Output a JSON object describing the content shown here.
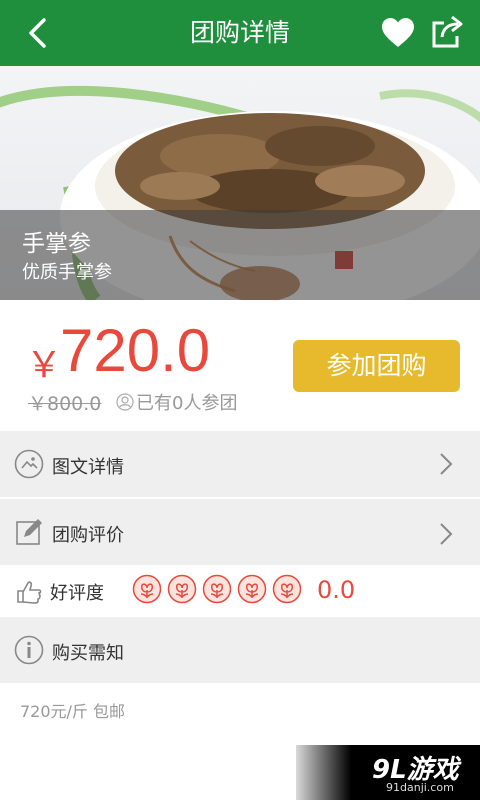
{
  "header": {
    "title": "团购详情"
  },
  "product": {
    "name": "手掌参",
    "subtitle": "优质手掌参"
  },
  "pricing": {
    "currency": "￥",
    "price": "720.0",
    "original_price": "￥800.0",
    "participants": "已有0人参团",
    "join_label": "参加团购"
  },
  "sections": {
    "details_label": "图文详情",
    "reviews_label": "团购评价",
    "rating_label": "好评度",
    "rating_score": "0.0",
    "notice_label": "购买需知",
    "notice_text": "720元/斤 包邮"
  },
  "watermark": {
    "main": "9L游戏",
    "sub": "91danji.com"
  },
  "colors": {
    "header": "#1f8f3d",
    "price": "#e8493c",
    "button": "#e7b92c"
  },
  "icons": [
    "back-icon",
    "heart-icon",
    "share-icon",
    "image-text-icon",
    "edit-icon",
    "thumb-icon",
    "star-icon",
    "info-icon",
    "chevron-right-icon",
    "user-icon"
  ]
}
